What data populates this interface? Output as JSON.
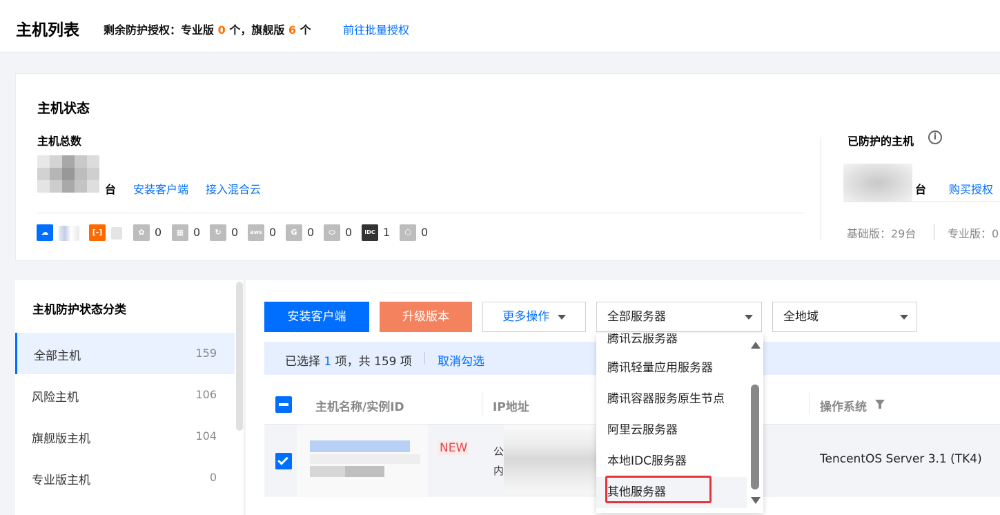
{
  "header": {
    "title": "主机列表",
    "quota_prefix": "剩余防护授权：专业版",
    "quota_pro_count": "0",
    "quota_mid": "个，旗舰版",
    "quota_flagship_count": "6",
    "quota_suffix": "个",
    "batch_link": "前往批量授权"
  },
  "status": {
    "title": "主机状态",
    "total_label": "主机总数",
    "unit": "台",
    "install_link": "安装客户端",
    "hybrid_link": "接入混合云",
    "clouds": [
      {
        "icon": "tencent-cloud-icon",
        "color": "#006eff",
        "count": ""
      },
      {
        "icon": "aliyun-icon",
        "color": "#ff6a00",
        "count": ""
      },
      {
        "icon": "huawei-cloud-icon",
        "color": "#bdbdbd",
        "count": "0"
      },
      {
        "icon": "azure-icon",
        "color": "#bdbdbd",
        "count": "0"
      },
      {
        "icon": "baidu-cloud-icon",
        "color": "#bdbdbd",
        "count": "0"
      },
      {
        "icon": "aws-icon",
        "color": "#bdbdbd",
        "count": "0"
      },
      {
        "icon": "google-cloud-icon",
        "color": "#bdbdbd",
        "count": "0"
      },
      {
        "icon": "oracle-cloud-icon",
        "color": "#bdbdbd",
        "count": "0"
      },
      {
        "icon": "idc-icon",
        "color": "#333333",
        "count": "1"
      },
      {
        "icon": "other-cloud-icon",
        "color": "#bdbdbd",
        "count": "0"
      }
    ],
    "protected_title": "已防护的主机",
    "protected_unit": "台",
    "buy_link": "购买授权",
    "basic_edition": "基础版：29台",
    "pro_edition": "专业版：0"
  },
  "sidebar": {
    "title": "主机防护状态分类",
    "items": [
      {
        "label": "全部主机",
        "count": "159"
      },
      {
        "label": "风险主机",
        "count": "106"
      },
      {
        "label": "旗舰版主机",
        "count": "104"
      },
      {
        "label": "专业版主机",
        "count": "0"
      }
    ]
  },
  "toolbar": {
    "install_button": "安装客户端",
    "upgrade_button": "升级版本",
    "more_button": "更多操作",
    "server_select": "全部服务器",
    "region_select": "全地域"
  },
  "selection": {
    "prefix": "已选择",
    "selected": "1",
    "middle": "项，共",
    "total": "159",
    "suffix": "项",
    "cancel": "取消勾选"
  },
  "table": {
    "col_name": "主机名称/实例ID",
    "col_ip": "IP地址",
    "col_os": "操作系统",
    "row": {
      "badge": "NEW",
      "ip_public": "公",
      "ip_private": "内",
      "os": "TencentOS Server 3.1 (TK4)"
    }
  },
  "dropdown": {
    "items": [
      "腾讯云服务器",
      "腾讯轻量应用服务器",
      "腾讯容器服务原生节点",
      "阿里云服务器",
      "本地IDC服务器",
      "其他服务器"
    ]
  },
  "colors": {
    "accent": "#006eff",
    "orange": "#ff7200",
    "upgrade": "#f5825e",
    "highlight": "#e2353a"
  }
}
